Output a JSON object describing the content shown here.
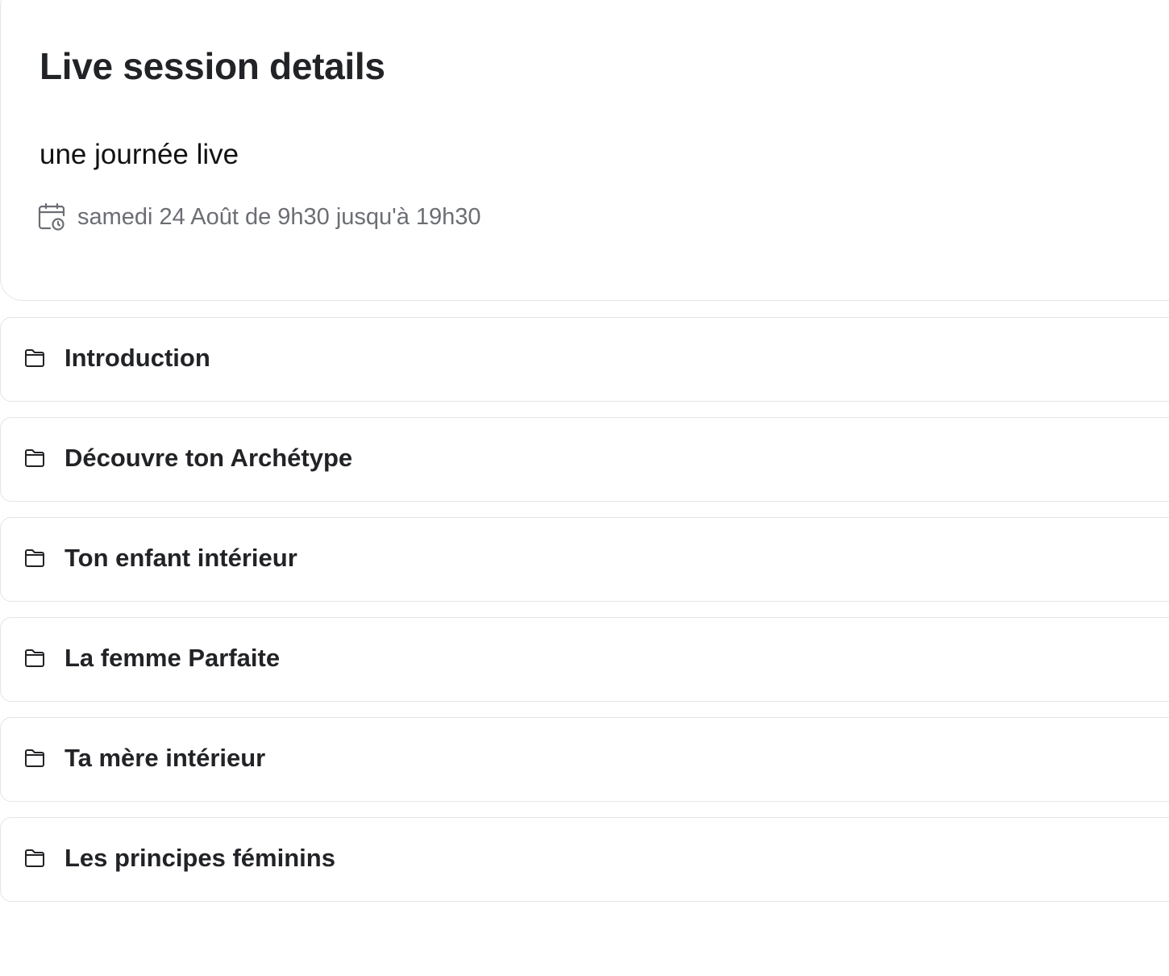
{
  "page": {
    "title": "Live session details"
  },
  "session": {
    "name": "une journée live",
    "schedule_icon": "calendar-clock-icon",
    "schedule": "samedi 24 Août de 9h30 jusqu'à 19h30"
  },
  "modules": [
    {
      "label": "Introduction",
      "icon": "folder-icon"
    },
    {
      "label": "Découvre ton Archétype",
      "icon": "folder-icon"
    },
    {
      "label": "Ton enfant intérieur",
      "icon": "folder-icon"
    },
    {
      "label": "La femme Parfaite",
      "icon": "folder-icon"
    },
    {
      "label": "Ta mère intérieur",
      "icon": "folder-icon"
    },
    {
      "label": "Les principes féminins",
      "icon": "folder-icon"
    }
  ],
  "colors": {
    "text_primary": "#222326",
    "text_secondary": "#6b6e74",
    "border": "#e4e5e8",
    "background": "#ffffff"
  }
}
